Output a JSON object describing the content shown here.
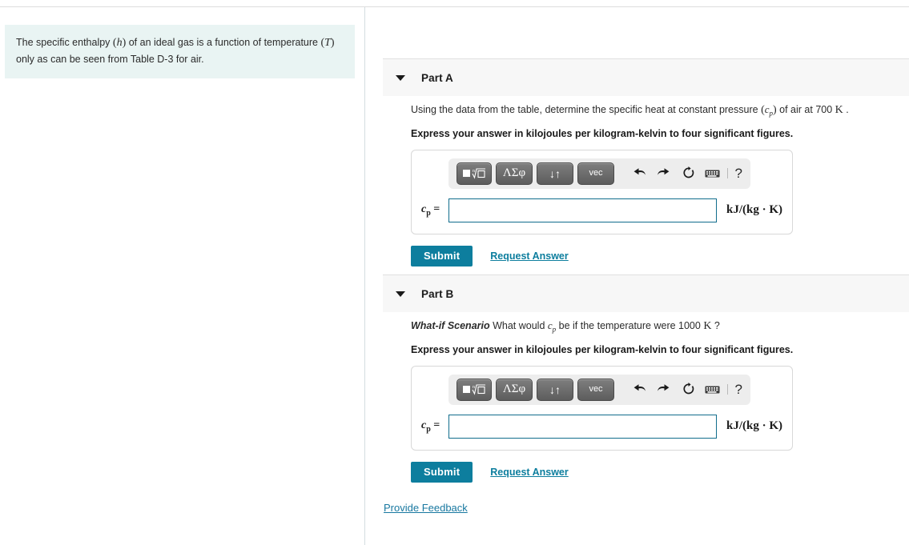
{
  "intro": {
    "text_before_h": "The specific enthalpy ",
    "var_h": "h",
    "text_mid": " of an ideal gas is a function of temperature ",
    "var_T": "T",
    "text_after": " only as can be seen from Table D-3 for air."
  },
  "math_toolbar": {
    "template_button": "■",
    "template_root": "√",
    "greek_button": "ΛΣφ",
    "arrows_button": "↓↑",
    "vec_button": "vec",
    "undo_icon": "undo-icon",
    "redo_icon": "redo-icon",
    "reset_icon": "reset-icon",
    "keyboard_icon": "keyboard-icon",
    "help_button": "?"
  },
  "parts": [
    {
      "id": "part-a",
      "title": "Part A",
      "prompt_plain_1": "Using the data from the table, determine the specific heat at constant pressure ",
      "prompt_var": "c",
      "prompt_var_sub": "p",
      "prompt_plain_2": " of air at 700 ",
      "prompt_unit": "K",
      "prompt_plain_3": " .",
      "instruction": "Express your answer in kilojoules per kilogram-kelvin to four significant figures.",
      "answer_label_var": "c",
      "answer_label_sub": "p",
      "answer_label_eq": " =",
      "answer_value": "",
      "answer_placeholder": "",
      "units": "kJ/(kg · K)",
      "submit_label": "Submit",
      "request_label": "Request Answer"
    },
    {
      "id": "part-b",
      "title": "Part B",
      "scenario_tag": "What-if Scenario",
      "prompt_plain_1": " What would ",
      "prompt_var": "c",
      "prompt_var_sub": "p",
      "prompt_plain_2": " be if the temperature were 1000 ",
      "prompt_unit": "K",
      "prompt_plain_3": " ?",
      "instruction": "Express your answer in kilojoules per kilogram-kelvin to four significant figures.",
      "answer_label_var": "c",
      "answer_label_sub": "p",
      "answer_label_eq": " =",
      "answer_value": "",
      "answer_placeholder": "",
      "units": "kJ/(kg · K)",
      "submit_label": "Submit",
      "request_label": "Request Answer"
    }
  ],
  "footer": {
    "feedback_label": "Provide Feedback"
  },
  "colors": {
    "accent_teal": "#0d7e9e",
    "link_teal": "#1878a0",
    "callout_bg": "#e9f4f3",
    "part_header_bg": "#f7f7f7",
    "input_border": "#116d8c"
  }
}
